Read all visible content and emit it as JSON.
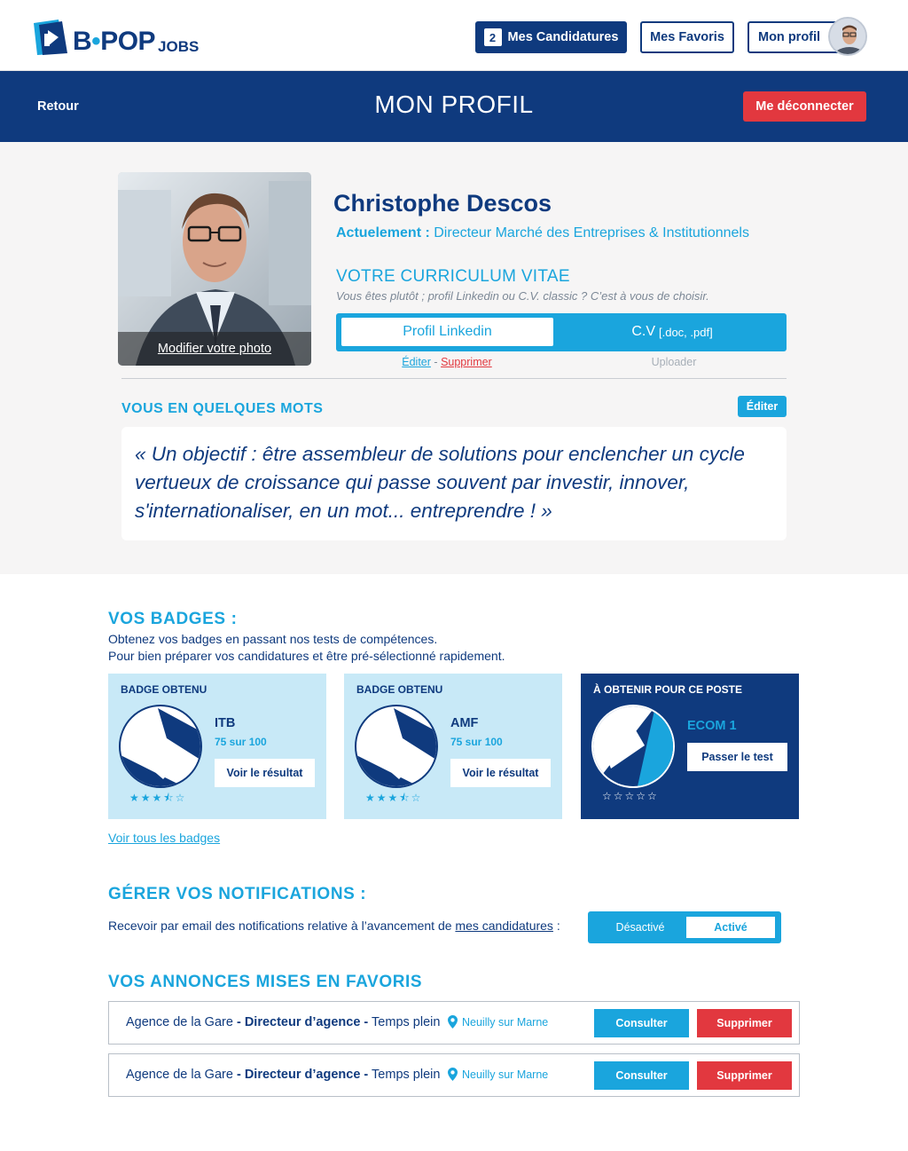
{
  "header": {
    "logo_main": "B",
    "logo_dot": "•",
    "logo_rest": "POP",
    "logo_jobs": "JOBS",
    "applications_count": "2",
    "applications_label": "Mes Candidatures",
    "favorites_label": "Mes Favoris",
    "profile_label": "Mon profil"
  },
  "band": {
    "back_label": "Retour",
    "title": "MON PROFIL",
    "logout_label": "Me déconnecter"
  },
  "profile": {
    "photo_caption": "Modifier votre photo",
    "name": "Christophe Descos",
    "current_label": "Actuelement :",
    "current_value": "Directeur Marché des Entreprises & Institutionnels",
    "cv_title": "VOTRE CURRICULUM VITAE",
    "cv_subtitle": "Vous êtes plutôt ; profil Linkedin ou C.V. classic ? C’est à vous de choisir.",
    "cv_option_linkedin": "Profil Linkedin",
    "cv_option_cv": "C.V",
    "cv_option_cv_ext": "[.doc, .pdf]",
    "edit_link": "Éditer",
    "separator": "-",
    "delete_link": "Supprimer",
    "upload_label": "Uploader"
  },
  "about": {
    "title": "VOUS EN QUELQUES MOTS",
    "edit_label": "Éditer",
    "quote": "« Un objectif : être assembleur de solutions pour enclencher un cycle vertueux de croissance qui passe souvent par investir, innover, s'internationaliser, en un mot... entreprendre ! »"
  },
  "badges": {
    "title": "VOS BADGES :",
    "line1": "Obtenez vos badges en passant nos tests de compétences.",
    "line2": "Pour bien préparer vos candidatures et être pré-sélectionné rapidement.",
    "items": [
      {
        "header": "BADGE OBTENU",
        "name": "ITB",
        "score": "75 sur 100",
        "button": "Voir le résultat",
        "stars": "★★★⯪☆"
      },
      {
        "header": "BADGE OBTENU",
        "name": "AMF",
        "score": "75 sur 100",
        "button": "Voir le résultat",
        "stars": "★★★⯪☆"
      },
      {
        "header": "À OBTENIR POUR CE POSTE",
        "name": "ECOM 1",
        "button": "Passer le test",
        "stars": "☆☆☆☆☆"
      }
    ],
    "see_all": "Voir tous les badges"
  },
  "notifications": {
    "title": "GÉRER VOS NOTIFICATIONS :",
    "text_before": "Recevoir par email des notifications relative à l’avancement de",
    "text_link": "mes candidatures",
    "text_after": ":",
    "off_label": "Désactivé",
    "on_label": "Activé"
  },
  "favorites": {
    "title": "VOS ANNONCES MISES EN FAVORIS",
    "items": [
      {
        "company": "Agence de la Gare",
        "sep1": "-",
        "position": "Directeur d’agence",
        "sep2": "-",
        "contract": "Temps plein",
        "location": "Neuilly sur Marne",
        "consult": "Consulter",
        "delete": "Supprimer"
      },
      {
        "company": "Agence de la Gare",
        "sep1": "-",
        "position": "Directeur d’agence",
        "sep2": "-",
        "contract": "Temps plein",
        "location": "Neuilly sur Marne",
        "consult": "Consulter",
        "delete": "Supprimer"
      }
    ]
  },
  "colors": {
    "navy": "#0f3a7e",
    "accent": "#1aa5dd",
    "danger": "#e2383f",
    "badge_bg": "#c8e9f7"
  }
}
